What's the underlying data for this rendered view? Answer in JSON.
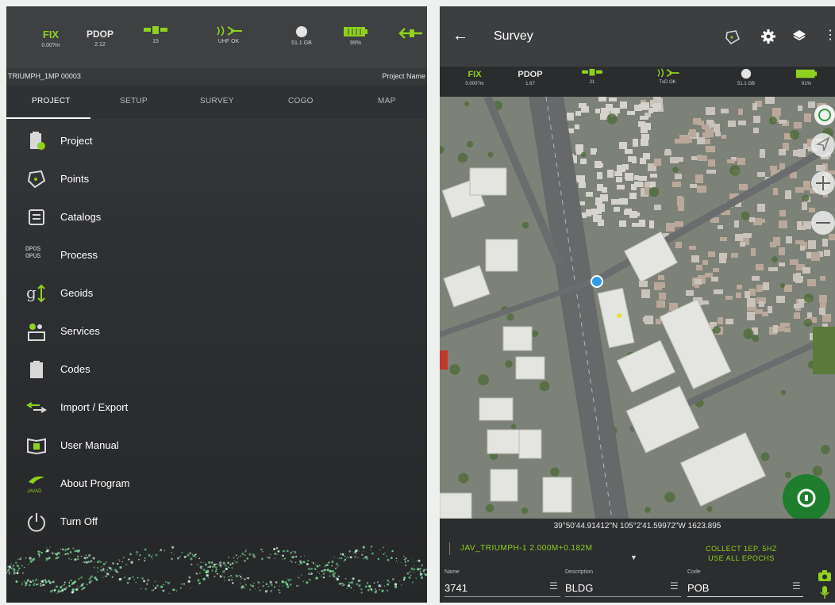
{
  "left_panel": {
    "status": {
      "fix_label": "FIX",
      "fix_value": "0.00?m",
      "pdop_label": "PDOP",
      "pdop_value": "2.12",
      "satellites": "15",
      "uhf": "UHF OK",
      "memory": "51.1 GB",
      "battery": "99%"
    },
    "device_name": "TRIUMPH_1MP 00003",
    "project_name": "Project Name",
    "tabs": [
      "PROJECT",
      "SETUP",
      "SURVEY",
      "COGO",
      "MAP"
    ],
    "menu": [
      {
        "label": "Project",
        "icon": "clipboard-icon"
      },
      {
        "label": "Points",
        "icon": "points-icon"
      },
      {
        "label": "Catalogs",
        "icon": "catalog-icon"
      },
      {
        "label": "Process",
        "icon": "dpos-opus-icon",
        "icon_text": "DPOS OPUS"
      },
      {
        "label": "Geoids",
        "icon": "geoid-icon"
      },
      {
        "label": "Services",
        "icon": "services-icon"
      },
      {
        "label": "Codes",
        "icon": "codes-icon"
      },
      {
        "label": "Import / Export",
        "icon": "import-export-icon"
      },
      {
        "label": "User Manual",
        "icon": "manual-icon"
      },
      {
        "label": "About Program",
        "icon": "javad-logo-icon",
        "icon_text": "JAVAD"
      },
      {
        "label": "Turn Off",
        "icon": "power-icon"
      }
    ]
  },
  "right_panel": {
    "title": "Survey",
    "status": {
      "fix_label": "FIX",
      "fix_value": "0.000?m",
      "pdop_label": "PDOP",
      "pdop_value": "1.67",
      "satellites": "21",
      "uhf": "TxD OK",
      "memory": "51.1 GB",
      "battery": "91%"
    },
    "coordinates": "39°50'44.91412\"N 105°2'41.59972\"W 1623.895",
    "gnss_line": "JAV_TRIUMPH-1 2.000M+0.182M",
    "collect_line1": "COLLECT 1EP. 5HZ",
    "collect_line2": "USE ALL EPOCHS",
    "fields": {
      "name_label": "Name",
      "name_value": "3741",
      "description_label": "Description",
      "description_value": "BLDG",
      "code_label": "Code",
      "code_value": "POB"
    }
  },
  "colors": {
    "accent_green": "#8fd11c",
    "dark_bg": "#2e3033",
    "fab_green": "#1f7d2e",
    "location_blue": "#2f9bea"
  }
}
